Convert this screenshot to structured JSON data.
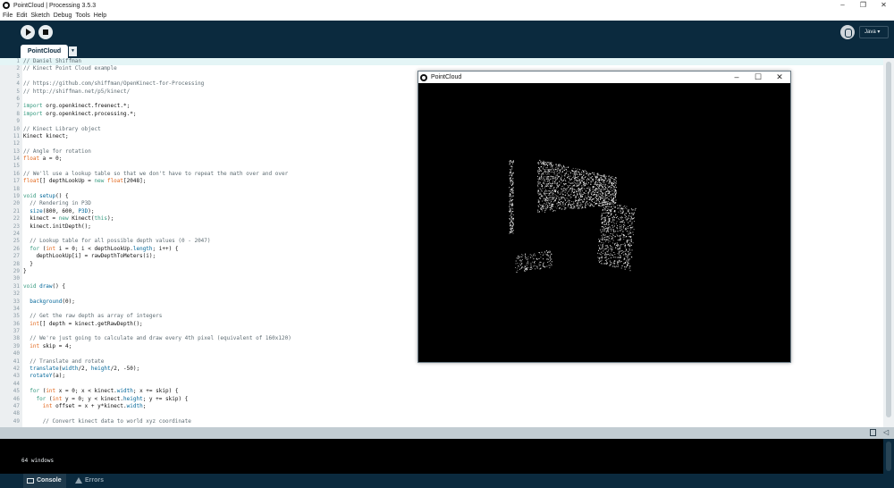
{
  "window": {
    "title": "PointCloud | Processing 3.5.3",
    "controls": [
      "–",
      "❐",
      "✕"
    ]
  },
  "menu": [
    "File",
    "Edit",
    "Sketch",
    "Debug",
    "Tools",
    "Help"
  ],
  "toolbar": {
    "mode": "Java ▾"
  },
  "tabs": [
    {
      "label": "PointCloud"
    }
  ],
  "tab_menu": "▼",
  "code_lines": [
    [
      {
        "t": "// Daniel Shiffman",
        "c": "c"
      }
    ],
    [
      {
        "t": "// Kinect Point Cloud example",
        "c": "c"
      }
    ],
    [],
    [
      {
        "t": "// https://github.com/shiffman/OpenKinect-for-Processing",
        "c": "c"
      }
    ],
    [
      {
        "t": "// http://shiffman.net/p5/kinect/",
        "c": "c"
      }
    ],
    [],
    [
      {
        "t": "import",
        "c": "k"
      },
      {
        "t": " org.openkinect.freenect.*;"
      }
    ],
    [
      {
        "t": "import",
        "c": "k"
      },
      {
        "t": " org.openkinect.processing.*;"
      }
    ],
    [],
    [
      {
        "t": "// Kinect Library object",
        "c": "c"
      }
    ],
    [
      {
        "t": "Kinect kinect;"
      }
    ],
    [],
    [
      {
        "t": "// Angle for rotation",
        "c": "c"
      }
    ],
    [
      {
        "t": "float",
        "c": "t"
      },
      {
        "t": " a = 0;"
      }
    ],
    [],
    [
      {
        "t": "// We'll use a lookup table so that we don't have to repeat the math over and over",
        "c": "c"
      }
    ],
    [
      {
        "t": "float",
        "c": "t"
      },
      {
        "t": "[] depthLookUp = "
      },
      {
        "t": "new",
        "c": "k"
      },
      {
        "t": " "
      },
      {
        "t": "float",
        "c": "t"
      },
      {
        "t": "[2048];"
      }
    ],
    [],
    [
      {
        "t": "void",
        "c": "k"
      },
      {
        "t": " "
      },
      {
        "t": "setup",
        "c": "f"
      },
      {
        "t": "() {"
      }
    ],
    [
      {
        "t": "  "
      },
      {
        "t": "// Rendering in P3D",
        "c": "c"
      }
    ],
    [
      {
        "t": "  "
      },
      {
        "t": "size",
        "c": "f"
      },
      {
        "t": "(800, 600, "
      },
      {
        "t": "P3D",
        "c": "f"
      },
      {
        "t": ");"
      }
    ],
    [
      {
        "t": "  kinect = "
      },
      {
        "t": "new",
        "c": "k"
      },
      {
        "t": " Kinect("
      },
      {
        "t": "this",
        "c": "k"
      },
      {
        "t": ");"
      }
    ],
    [
      {
        "t": "  kinect.initDepth();"
      }
    ],
    [],
    [
      {
        "t": "  "
      },
      {
        "t": "// Lookup table for all possible depth values (0 - 2047)",
        "c": "c"
      }
    ],
    [
      {
        "t": "  "
      },
      {
        "t": "for",
        "c": "k"
      },
      {
        "t": " ("
      },
      {
        "t": "int",
        "c": "t"
      },
      {
        "t": " i = 0; i < depthLookUp."
      },
      {
        "t": "length",
        "c": "f"
      },
      {
        "t": "; i++) {"
      }
    ],
    [
      {
        "t": "    depthLookUp[i] = rawDepthToMeters(i);"
      }
    ],
    [
      {
        "t": "  }"
      }
    ],
    [
      {
        "t": "}"
      }
    ],
    [],
    [
      {
        "t": "void",
        "c": "k"
      },
      {
        "t": " "
      },
      {
        "t": "draw",
        "c": "f"
      },
      {
        "t": "() {"
      }
    ],
    [],
    [
      {
        "t": "  "
      },
      {
        "t": "background",
        "c": "f"
      },
      {
        "t": "(0);"
      }
    ],
    [],
    [
      {
        "t": "  "
      },
      {
        "t": "// Get the raw depth as array of integers",
        "c": "c"
      }
    ],
    [
      {
        "t": "  "
      },
      {
        "t": "int",
        "c": "t"
      },
      {
        "t": "[] depth = kinect.getRawDepth();"
      }
    ],
    [],
    [
      {
        "t": "  "
      },
      {
        "t": "// We're just going to calculate and draw every 4th pixel (equivalent of 160x120)",
        "c": "c"
      }
    ],
    [
      {
        "t": "  "
      },
      {
        "t": "int",
        "c": "t"
      },
      {
        "t": " skip = 4;"
      }
    ],
    [],
    [
      {
        "t": "  "
      },
      {
        "t": "// Translate and rotate",
        "c": "c"
      }
    ],
    [
      {
        "t": "  "
      },
      {
        "t": "translate",
        "c": "f"
      },
      {
        "t": "("
      },
      {
        "t": "width",
        "c": "f"
      },
      {
        "t": "/2, "
      },
      {
        "t": "height",
        "c": "f"
      },
      {
        "t": "/2, -50);"
      }
    ],
    [
      {
        "t": "  "
      },
      {
        "t": "rotateY",
        "c": "f"
      },
      {
        "t": "(a);"
      }
    ],
    [],
    [
      {
        "t": "  "
      },
      {
        "t": "for",
        "c": "k"
      },
      {
        "t": " ("
      },
      {
        "t": "int",
        "c": "t"
      },
      {
        "t": " x = 0; x < kinect."
      },
      {
        "t": "width",
        "c": "f"
      },
      {
        "t": "; x += skip) {"
      }
    ],
    [
      {
        "t": "    "
      },
      {
        "t": "for",
        "c": "k"
      },
      {
        "t": " ("
      },
      {
        "t": "int",
        "c": "t"
      },
      {
        "t": " y = 0; y < kinect."
      },
      {
        "t": "height",
        "c": "f"
      },
      {
        "t": "; y += skip) {"
      }
    ],
    [
      {
        "t": "      "
      },
      {
        "t": "int",
        "c": "t"
      },
      {
        "t": " offset = x + y*kinect."
      },
      {
        "t": "width",
        "c": "f"
      },
      {
        "t": ";"
      }
    ],
    [],
    [
      {
        "t": "      "
      },
      {
        "t": "// Convert kinect data to world xyz coordinate",
        "c": "c"
      }
    ]
  ],
  "sketch_window": {
    "title": "PointCloud",
    "controls": [
      "–",
      "☐",
      "✕"
    ]
  },
  "console": {
    "text": "64 windows"
  },
  "footer": {
    "console_label": "Console",
    "errors_label": "Errors"
  }
}
